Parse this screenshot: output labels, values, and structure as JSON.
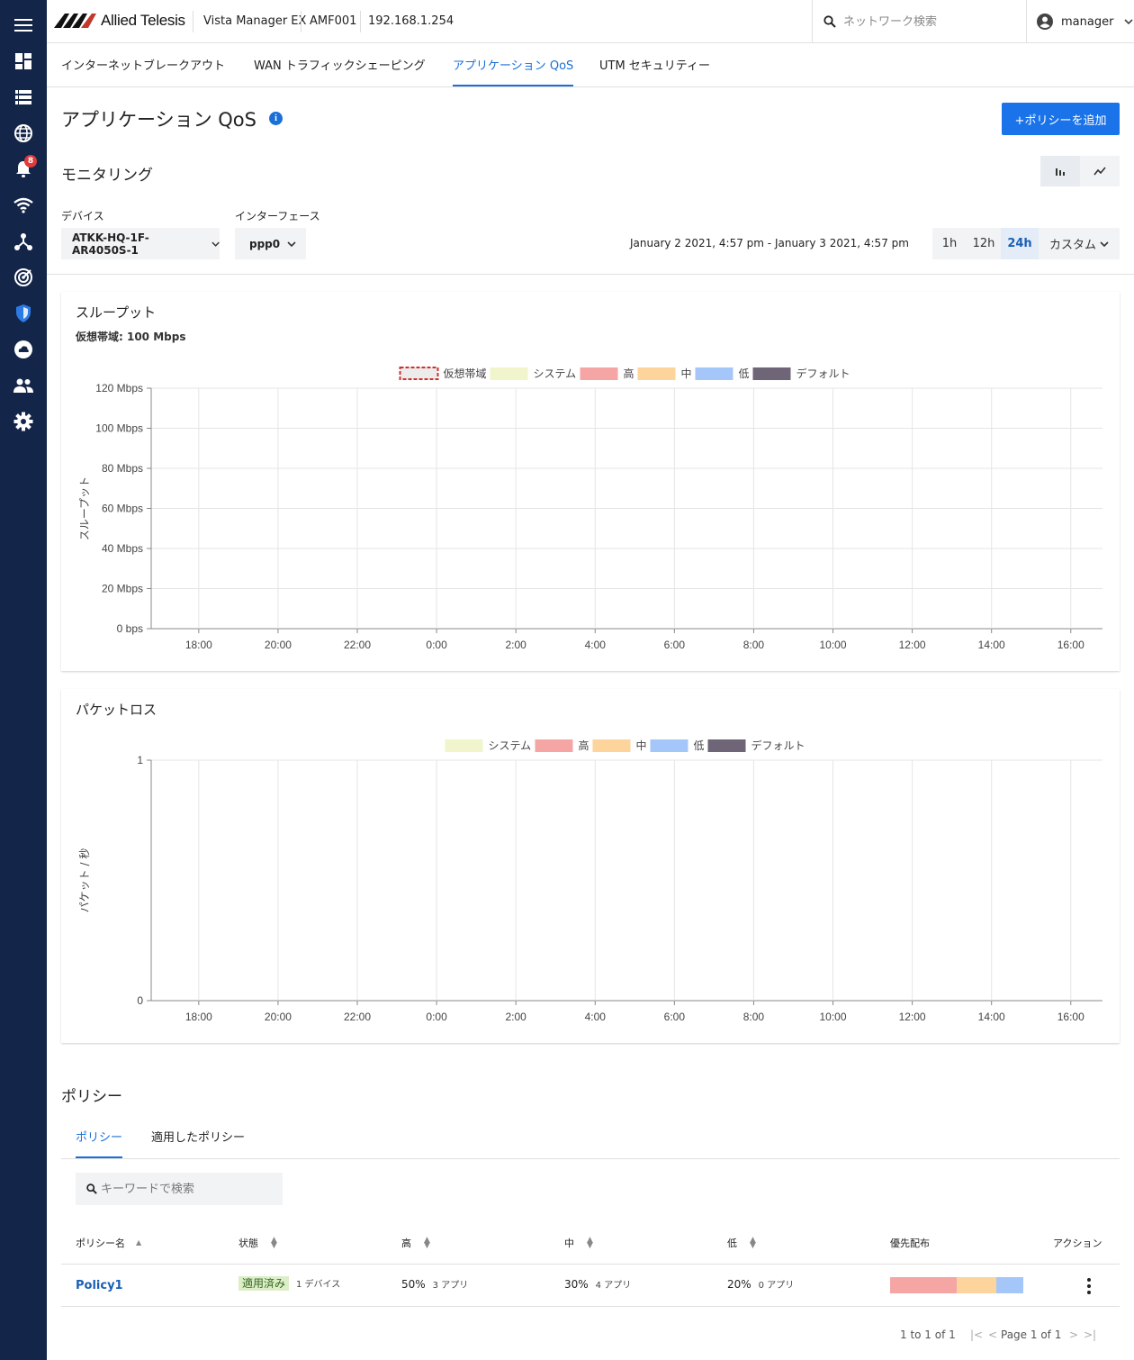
{
  "header": {
    "brand": "Allied Telesis",
    "product": "Vista Manager EX",
    "device": "AMF001",
    "ip": "192.168.1.254",
    "search_placeholder": "ネットワーク検索",
    "user": "manager"
  },
  "nav": {
    "alert_count": "8",
    "items": [
      "menu-icon",
      "dashboard-icon",
      "list-icon",
      "globe-icon",
      "alert-bell-icon",
      "wifi-icon",
      "topology-icon",
      "radar-icon",
      "security-shield-icon",
      "cloud-icon",
      "users-icon",
      "settings-gear-icon"
    ]
  },
  "tabs": [
    {
      "label": "インターネットブレークアウト"
    },
    {
      "label": "WAN トラフィックシェーピング"
    },
    {
      "label": "アプリケーション QoS",
      "active": true
    },
    {
      "label": "UTM セキュリティー"
    }
  ],
  "page": {
    "title": "アプリケーション QoS",
    "info": "i",
    "add_button": "+ポリシーを追加"
  },
  "monitoring": {
    "title": "モニタリング",
    "device_label": "デバイス",
    "device_value": "ATKK-HQ-1F-AR4050S-1",
    "interface_label": "インターフェース",
    "interface_value": "ppp0",
    "date_range": "January 2 2021, 4:57 pm - January 3 2021, 4:57 pm",
    "ranges": [
      "1h",
      "12h",
      "24h",
      "カスタム"
    ],
    "selected_range": "24h"
  },
  "colors": {
    "system": "#f0f5cc",
    "high": "#f6a5a5",
    "mid": "#fdd49b",
    "low": "#a4c6f9",
    "default": "#6e6576",
    "accent": "#1a73e8"
  },
  "chart_data": [
    {
      "type": "area",
      "title": "スループット",
      "subtitle": "仮想帯域: 100 Mbps",
      "ylabel": "スループット",
      "legend": [
        "仮想帯域",
        "システム",
        "高",
        "中",
        "低",
        "デフォルト"
      ],
      "legend_placement": "top-center",
      "y_ticks": [
        "0 bps",
        "20 Mbps",
        "40 Mbps",
        "60 Mbps",
        "80 Mbps",
        "100 Mbps",
        "120 Mbps"
      ],
      "x_ticks": [
        "18:00",
        "20:00",
        "22:00",
        "0:00",
        "2:00",
        "4:00",
        "6:00",
        "8:00",
        "10:00",
        "12:00",
        "14:00",
        "16:00"
      ],
      "ylim": [
        0,
        120
      ],
      "grid": true,
      "series": []
    },
    {
      "type": "area",
      "title": "パケットロス",
      "ylabel": "パケット / 秒",
      "legend": [
        "システム",
        "高",
        "中",
        "低",
        "デフォルト"
      ],
      "legend_placement": "top-center",
      "y_ticks": [
        "0",
        "1"
      ],
      "x_ticks": [
        "18:00",
        "20:00",
        "22:00",
        "0:00",
        "2:00",
        "4:00",
        "6:00",
        "8:00",
        "10:00",
        "12:00",
        "14:00",
        "16:00"
      ],
      "ylim": [
        0,
        1
      ],
      "grid": true,
      "series": []
    }
  ],
  "policies": {
    "title": "ポリシー",
    "tabs": [
      "ポリシー",
      "適用したポリシー"
    ],
    "search_placeholder": "キーワードで検索",
    "columns": [
      "ポリシー名",
      "状態",
      "高",
      "中",
      "低",
      "優先配布",
      "アクション"
    ],
    "rows": [
      {
        "name": "Policy1",
        "status": "適用済み",
        "devices": "1 デバイス",
        "high": "50%",
        "high_apps": "3 アプリ",
        "mid": "30%",
        "mid_apps": "4 アプリ",
        "low": "20%",
        "low_apps": "0 アプリ",
        "distribution": [
          0.5,
          0.3,
          0.2
        ]
      }
    ],
    "pager_count": "1 to 1 of 1",
    "pager_page": "Page 1 of 1"
  }
}
